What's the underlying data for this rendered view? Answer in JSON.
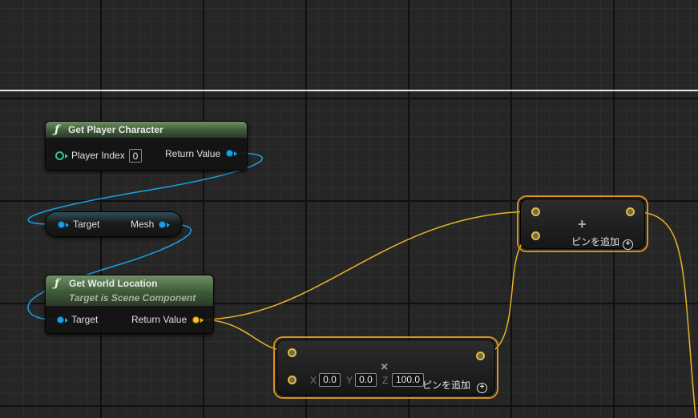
{
  "colors": {
    "graph_background": "#262626",
    "exec_wire": "#1aa1ea",
    "vector_wire": "#e6b425",
    "selection_outline": "#f0b233",
    "function_header": "#4f7249"
  },
  "nodes": {
    "get_player_character": {
      "icon": "function-icon",
      "title": "Get Player Character",
      "input_label": "Player Index",
      "input_value": "0",
      "output_label": "Return Value"
    },
    "mesh_getter": {
      "input_label": "Target",
      "output_label": "Mesh"
    },
    "get_world_location": {
      "icon": "function-icon",
      "title": "Get World Location",
      "subtitle": "Target is Scene Component",
      "input_label": "Target",
      "output_label": "Return Value"
    },
    "add_vector_top": {
      "operator": "+",
      "add_pin_label": "ピンを追加",
      "add_pin_icon": "⊕"
    },
    "multiply_vector_bottom": {
      "operator": "×",
      "x_label": "X",
      "x_value": "0.0",
      "y_label": "Y",
      "y_value": "0.0",
      "z_label": "Z",
      "z_value": "100.0",
      "add_pin_label": "ピンを追加",
      "add_pin_icon": "⊕"
    }
  }
}
